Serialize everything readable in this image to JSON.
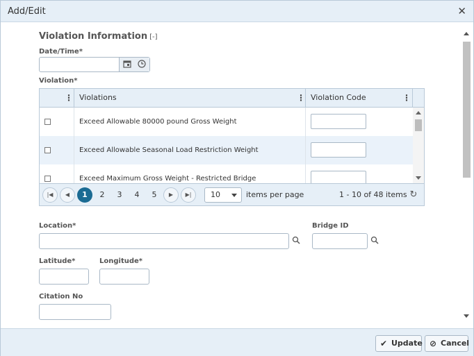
{
  "window": {
    "title": "Add/Edit"
  },
  "section": {
    "title": "Violation Information",
    "toggle": "[-]"
  },
  "labels": {
    "datetime": "Date/Time*",
    "violation": "Violation*",
    "location": "Location*",
    "bridge_id": "Bridge ID",
    "latitude": "Latitude*",
    "longitude": "Longitude*",
    "citation_no": "Citation No"
  },
  "grid": {
    "columns": [
      {
        "label": "Violations"
      },
      {
        "label": "Violation Code"
      }
    ],
    "rows": [
      {
        "violation": "Exceed Allowable 80000 pound Gross Weight",
        "code": ""
      },
      {
        "violation": "Exceed Allowable Seasonal Load Restriction Weight",
        "code": ""
      },
      {
        "violation": "Exceed Maximum Gross Weight - Restricted Bridge",
        "code": ""
      }
    ],
    "pager": {
      "pages": [
        "1",
        "2",
        "3",
        "4",
        "5"
      ],
      "active_page": "1",
      "page_size": "10",
      "items_per_page_label": "items per page",
      "summary": "1 - 10 of 48 items"
    }
  },
  "fields": {
    "datetime": "",
    "location": "",
    "bridge_id": "",
    "latitude": "",
    "longitude": "",
    "citation_no": ""
  },
  "footer": {
    "update_label": "Update",
    "cancel_label": "Cancel"
  },
  "colors": {
    "header_bg": "#e6eff7",
    "active_page": "#1b6b93",
    "alt_row": "#eaf2fa",
    "border": "#b9c9d8"
  }
}
